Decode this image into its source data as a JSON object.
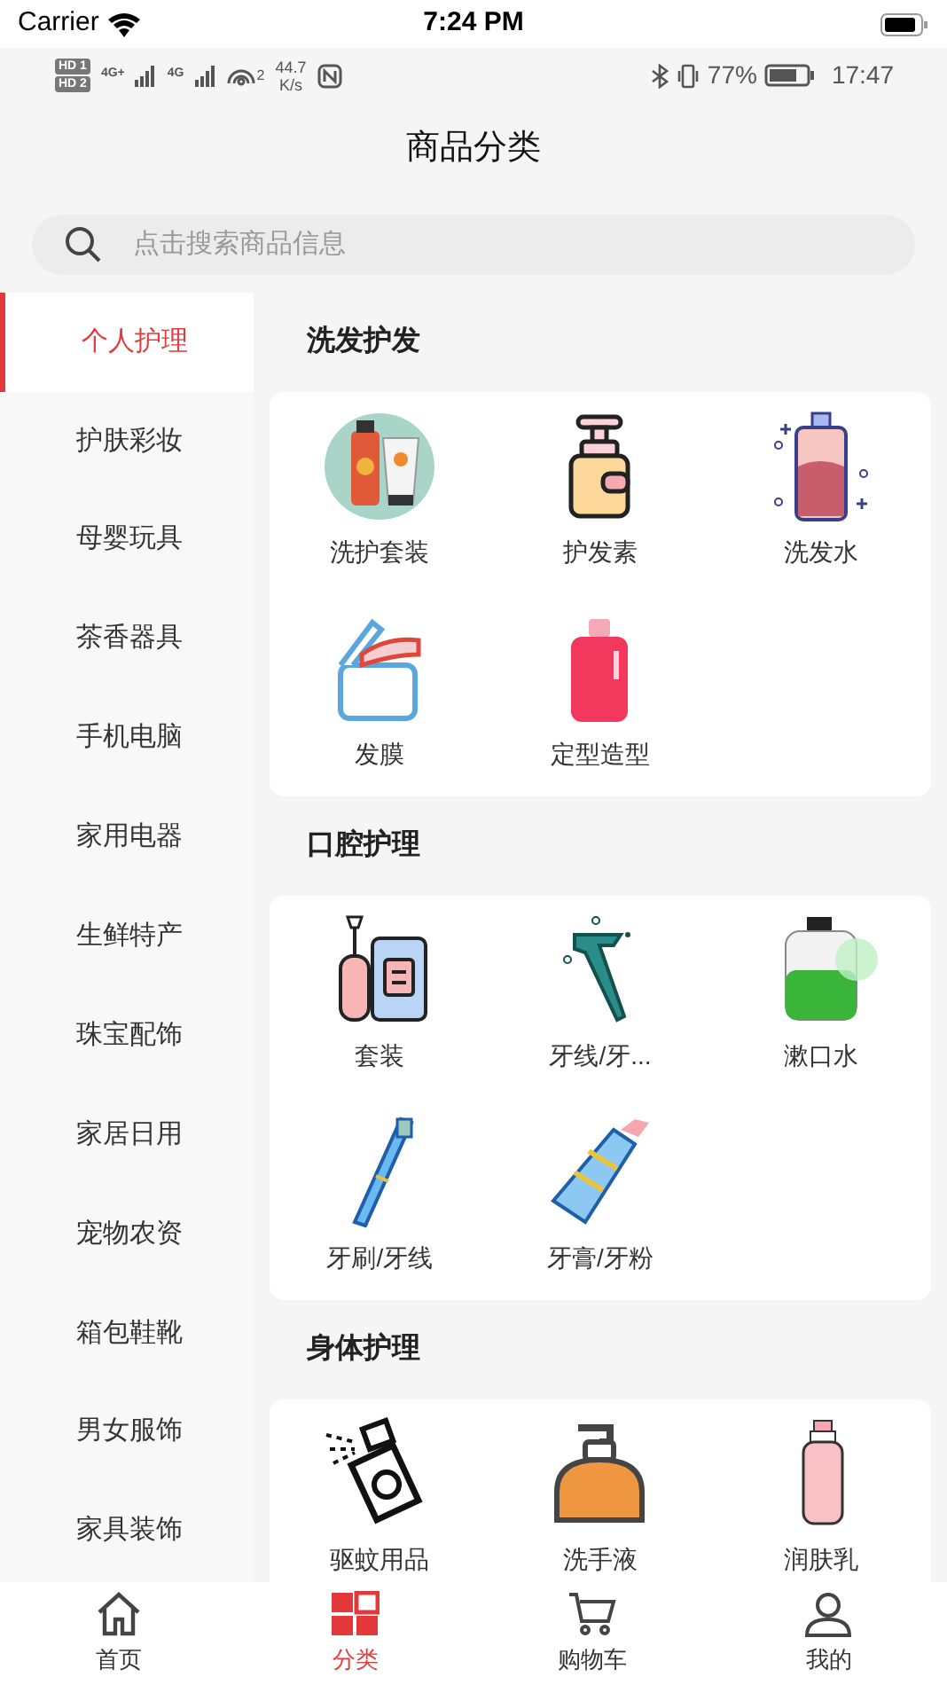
{
  "ios_status_bar": {
    "carrier": "Carrier",
    "time": "7:24 PM"
  },
  "android_status_bar": {
    "sim_1": "HD 1",
    "sim_2": "HD 2",
    "network_1": "4G+",
    "network_2": "4G",
    "hotspot_count": "2",
    "speed": "44.7",
    "speed_unit": "K/s",
    "battery": "77%",
    "time": "17:47"
  },
  "header": {
    "title": "商品分类"
  },
  "search": {
    "placeholder": "点击搜索商品信息"
  },
  "sidebar": {
    "items": [
      {
        "label": "个人护理",
        "selected": true
      },
      {
        "label": "护肤彩妆",
        "selected": false
      },
      {
        "label": "母婴玩具",
        "selected": false
      },
      {
        "label": "茶香器具",
        "selected": false
      },
      {
        "label": "手机电脑",
        "selected": false
      },
      {
        "label": "家用电器",
        "selected": false
      },
      {
        "label": "生鲜特产",
        "selected": false
      },
      {
        "label": "珠宝配饰",
        "selected": false
      },
      {
        "label": "家居日用",
        "selected": false
      },
      {
        "label": "宠物农资",
        "selected": false
      },
      {
        "label": "箱包鞋靴",
        "selected": false
      },
      {
        "label": "男女服饰",
        "selected": false
      },
      {
        "label": "家具装饰",
        "selected": false
      }
    ]
  },
  "sections": [
    {
      "title": "洗发护发",
      "items": [
        "洗护套装",
        "护发素",
        "洗发水",
        "发膜",
        "定型造型"
      ]
    },
    {
      "title": "口腔护理",
      "items": [
        "套装",
        "牙线/牙...",
        "漱口水",
        "牙刷/牙线",
        "牙膏/牙粉"
      ]
    },
    {
      "title": "身体护理",
      "items": [
        "驱蚊用品",
        "洗手液",
        "润肤乳"
      ]
    }
  ],
  "tab_bar": [
    {
      "label": "首页",
      "kind": "home",
      "selected": false
    },
    {
      "label": "分类",
      "kind": "category",
      "selected": true
    },
    {
      "label": "购物车",
      "kind": "cart",
      "selected": false
    },
    {
      "label": "我的",
      "kind": "profile",
      "selected": false
    }
  ]
}
